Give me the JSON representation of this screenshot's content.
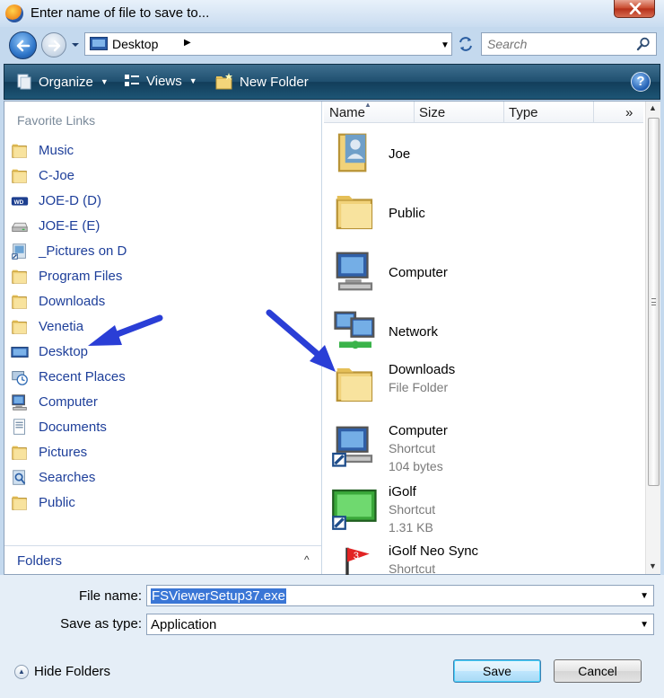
{
  "window": {
    "title": "Enter name of file to save to..."
  },
  "address": {
    "location": "Desktop",
    "search_placeholder": "Search"
  },
  "toolbar": {
    "organize": "Organize",
    "views": "Views",
    "new_folder": "New Folder",
    "help": "?"
  },
  "favorites": {
    "header": "Favorite Links",
    "items": [
      {
        "label": "Music",
        "icon": "folder-icon"
      },
      {
        "label": "C-Joe",
        "icon": "folder-icon"
      },
      {
        "label": "JOE-D (D)",
        "icon": "wd-drive-icon"
      },
      {
        "label": "JOE-E (E)",
        "icon": "drive-icon"
      },
      {
        "label": "_Pictures on D",
        "icon": "pictures-shortcut-icon"
      },
      {
        "label": "Program Files",
        "icon": "folder-icon"
      },
      {
        "label": "Downloads",
        "icon": "folder-icon"
      },
      {
        "label": "Venetia",
        "icon": "folder-icon"
      },
      {
        "label": "Desktop",
        "icon": "desktop-icon"
      },
      {
        "label": "Recent Places",
        "icon": "recent-places-icon"
      },
      {
        "label": "Computer",
        "icon": "computer-icon"
      },
      {
        "label": "Documents",
        "icon": "documents-icon"
      },
      {
        "label": "Pictures",
        "icon": "folder-icon"
      },
      {
        "label": "Searches",
        "icon": "searches-icon"
      },
      {
        "label": "Public",
        "icon": "folder-icon"
      }
    ],
    "folders_label": "Folders"
  },
  "columns": {
    "name": "Name",
    "size": "Size",
    "type": "Type",
    "more": "»"
  },
  "files": [
    {
      "name": "Joe",
      "sub1": "",
      "sub2": "",
      "icon": "user-folder-icon"
    },
    {
      "name": "Public",
      "sub1": "",
      "sub2": "",
      "icon": "folder-icon"
    },
    {
      "name": "Computer",
      "sub1": "",
      "sub2": "",
      "icon": "computer-icon"
    },
    {
      "name": "Network",
      "sub1": "",
      "sub2": "",
      "icon": "network-icon"
    },
    {
      "name": "Downloads",
      "sub1": "File Folder",
      "sub2": "",
      "icon": "folder-icon"
    },
    {
      "name": "Computer",
      "sub1": "Shortcut",
      "sub2": "104 bytes",
      "icon": "computer-shortcut-icon"
    },
    {
      "name": "iGolf",
      "sub1": "Shortcut",
      "sub2": "1.31 KB",
      "icon": "igolf-icon"
    },
    {
      "name": "iGolf Neo Sync",
      "sub1": "Shortcut",
      "sub2": "",
      "icon": "igolf-flag-icon"
    }
  ],
  "form": {
    "file_name_label": "File name:",
    "file_name_value": "FSViewerSetup37.exe",
    "save_type_label": "Save as type:",
    "save_type_value": "Application",
    "hide_folders": "Hide Folders",
    "save": "Save",
    "cancel": "Cancel"
  },
  "colors": {
    "link_blue": "#1e3f9a",
    "toolbar": "#1f4f6f",
    "annotation_arrow": "#2a3ed6"
  }
}
